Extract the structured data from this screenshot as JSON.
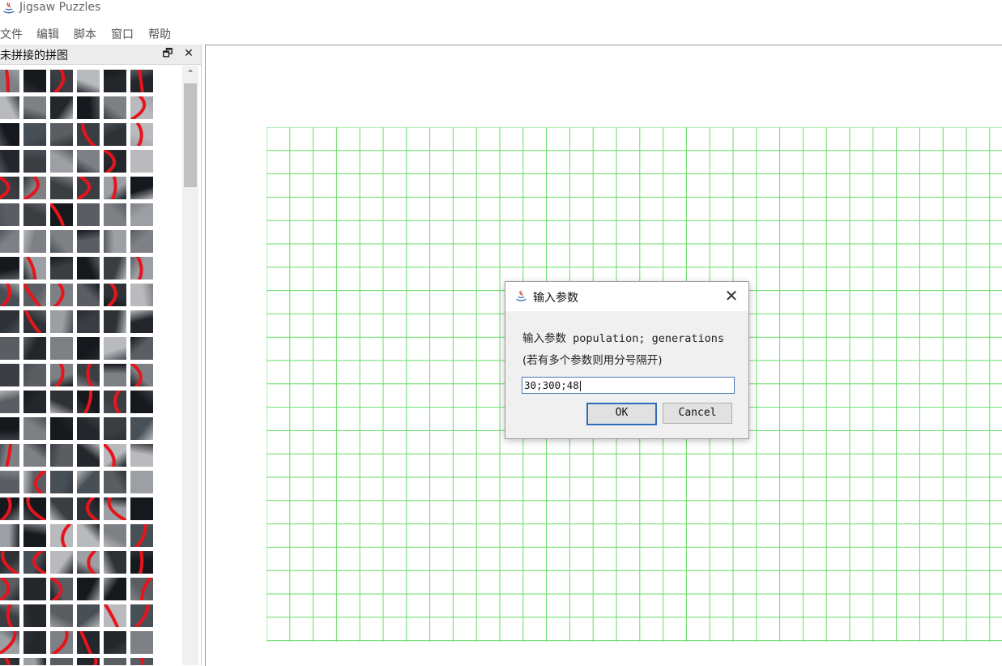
{
  "window": {
    "title": "Jigsaw Puzzles",
    "app_icon": "java-duke-icon"
  },
  "menubar": {
    "items": [
      "文件",
      "编辑",
      "脚本",
      "窗口",
      "帮助"
    ]
  },
  "dock": {
    "title": "未拼接的拼图",
    "restore_icon": "restore-window-icon",
    "close_icon": "close-icon",
    "restore_glyph": "🗗",
    "close_glyph": "✕",
    "scroll_up_glyph": "⌃"
  },
  "grid": {
    "color": "#66dd66"
  },
  "dialog": {
    "title": "输入参数",
    "close_glyph": "✕",
    "message_line1": "输入参数 population; generations",
    "message_line2": "(若有多个参数则用分号隔开)",
    "input_value": "30;300;48",
    "ok_label": "OK",
    "cancel_label": "Cancel"
  },
  "colors": {
    "accent_red": "#e8141c",
    "focus_blue": "#2c6bbd"
  }
}
